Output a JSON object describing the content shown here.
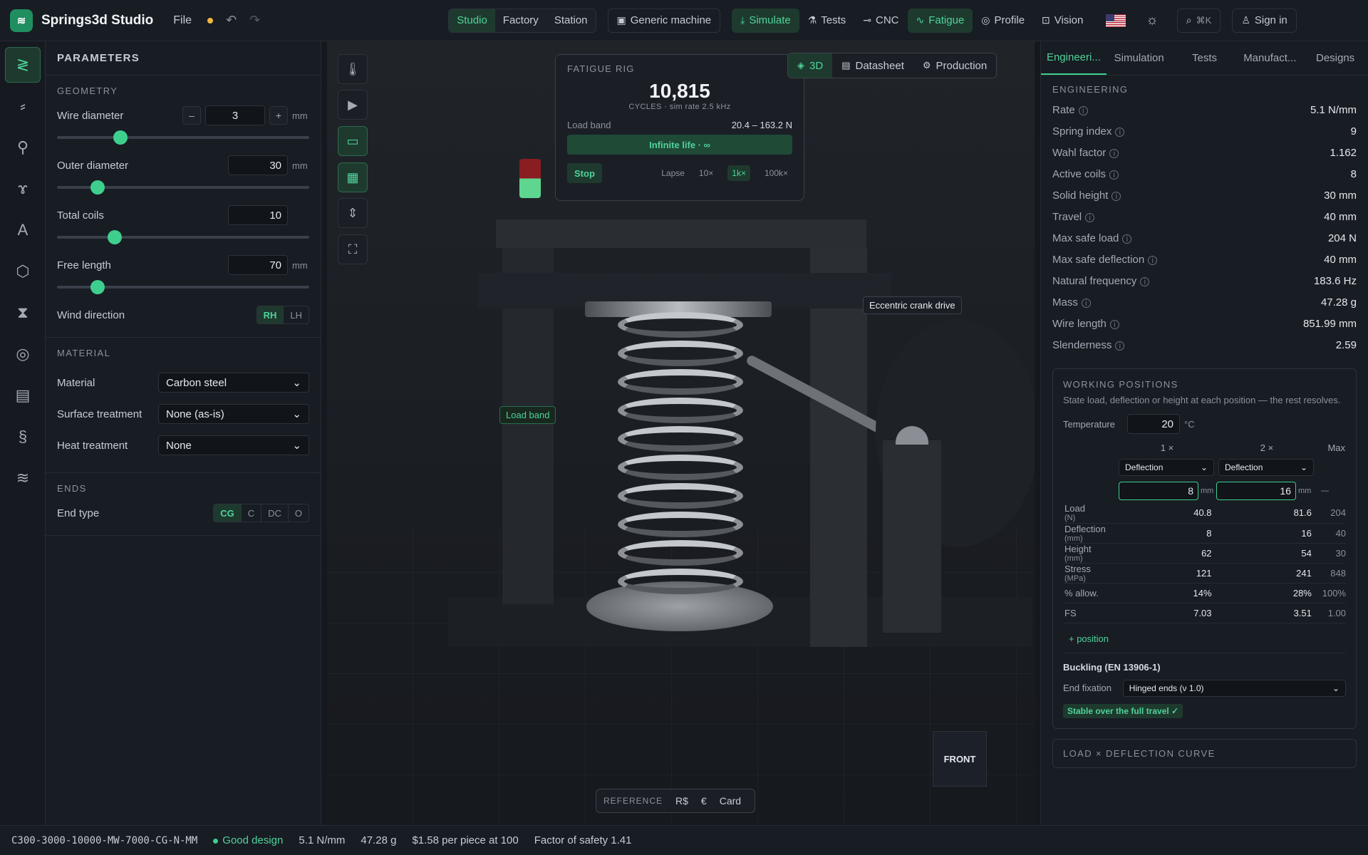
{
  "app": {
    "name": "Springs3d Studio",
    "file_menu": "File"
  },
  "topbar": {
    "modes": [
      "Studio",
      "Factory",
      "Station"
    ],
    "machine": "Generic machine",
    "simulate": "Simulate",
    "tests": "Tests",
    "cnc": "CNC",
    "fatigue": "Fatigue",
    "profile": "Profile",
    "vision": "Vision",
    "search_hint": "⌘K",
    "sign_in": "Sign in"
  },
  "params": {
    "title": "PARAMETERS",
    "geometry_title": "GEOMETRY",
    "wire_diameter": {
      "label": "Wire diameter",
      "value": "3",
      "unit": "mm",
      "level": 0.25
    },
    "outer_diameter": {
      "label": "Outer diameter",
      "value": "30",
      "unit": "mm",
      "level": 0.16
    },
    "total_coils": {
      "label": "Total coils",
      "value": "10",
      "level": 0.23
    },
    "free_length": {
      "label": "Free length",
      "value": "70",
      "unit": "mm",
      "level": 0.16
    },
    "wind_direction": {
      "label": "Wind direction",
      "options": [
        "RH",
        "LH"
      ]
    },
    "material_title": "MATERIAL",
    "material": {
      "label": "Material",
      "value": "Carbon steel"
    },
    "surface": {
      "label": "Surface treatment",
      "value": "None (as-is)"
    },
    "heat": {
      "label": "Heat treatment",
      "value": "None"
    },
    "ends_title": "ENDS",
    "end_type": {
      "label": "End type",
      "options": [
        "CG",
        "C",
        "DC",
        "O"
      ]
    }
  },
  "fatigue_card": {
    "title": "FATIGUE RIG",
    "cycles": "10,815",
    "sub": "CYCLES · sim rate 2.5 kHz",
    "load_band_label": "Load band",
    "load_band_value": "20.4 – 163.2 N",
    "life": "Infinite life · ∞",
    "stop": "Stop",
    "lapse": "Lapse",
    "rates": [
      "10×",
      "1k×",
      "100k×"
    ]
  },
  "view_tabs": [
    "3D",
    "Datasheet",
    "Production"
  ],
  "labels": {
    "crank": "Eccentric crank drive",
    "load_band": "Load band",
    "front": "FRONT"
  },
  "reference": {
    "label": "REFERENCE",
    "items": [
      "R$",
      "€",
      "Card"
    ]
  },
  "right": {
    "tabs": [
      "Engineeri...",
      "Simulation",
      "Tests",
      "Manufact...",
      "Designs"
    ],
    "eng_title": "ENGINEERING",
    "rows": [
      {
        "k": "Rate",
        "v": "5.1 N/mm"
      },
      {
        "k": "Spring index",
        "v": "9"
      },
      {
        "k": "Wahl factor",
        "v": "1.162"
      },
      {
        "k": "Active coils",
        "v": "8"
      },
      {
        "k": "Solid height",
        "v": "30 mm"
      },
      {
        "k": "Travel",
        "v": "40 mm"
      },
      {
        "k": "Max safe load",
        "v": "204 N"
      },
      {
        "k": "Max safe deflection",
        "v": "40 mm"
      },
      {
        "k": "Natural frequency",
        "v": "183.6 Hz"
      },
      {
        "k": "Mass",
        "v": "47.28 g"
      },
      {
        "k": "Wire length",
        "v": "851.99 mm"
      },
      {
        "k": "Slenderness",
        "v": "2.59"
      }
    ],
    "wp": {
      "title": "WORKING POSITIONS",
      "sub": "State load, deflection or height at each position — the rest resolves.",
      "temp_label": "Temperature",
      "temp_value": "20",
      "temp_unit": "°C",
      "col1": "1",
      "col2": "2",
      "colmax": "Max",
      "close": "×",
      "mode1": "Deflection",
      "mode2": "Deflection",
      "in1": "8",
      "in2": "16",
      "unit": "mm",
      "dash": "—",
      "rows": [
        {
          "k": "Load",
          "u": "(N)",
          "a": "40.8",
          "b": "81.6",
          "m": "204"
        },
        {
          "k": "Deflection",
          "u": "(mm)",
          "a": "8",
          "b": "16",
          "m": "40"
        },
        {
          "k": "Height",
          "u": "(mm)",
          "a": "62",
          "b": "54",
          "m": "30"
        },
        {
          "k": "Stress",
          "u": "(MPa)",
          "a": "121",
          "b": "241",
          "m": "848"
        },
        {
          "k": "% allow.",
          "u": "",
          "a": "14%",
          "b": "28%",
          "m": "100%"
        },
        {
          "k": "FS",
          "u": "",
          "a": "7.03",
          "b": "3.51",
          "m": "1.00"
        }
      ],
      "add": "+ position",
      "buckling_title": "Buckling (EN 13906-1)",
      "end_fixation_label": "End fixation",
      "end_fixation_value": "Hinged ends (ν 1.0)",
      "stable": "Stable over the full travel ✓"
    },
    "curve_title": "LOAD × DEFLECTION CURVE"
  },
  "status": {
    "code": "C300-3000-10000-MW-7000-CG-N-MM",
    "good": "Good design",
    "rate": "5.1 N/mm",
    "mass": "47.28 g",
    "price": "$1.58 per piece at 100",
    "fos": "Factor of safety 1.41"
  }
}
